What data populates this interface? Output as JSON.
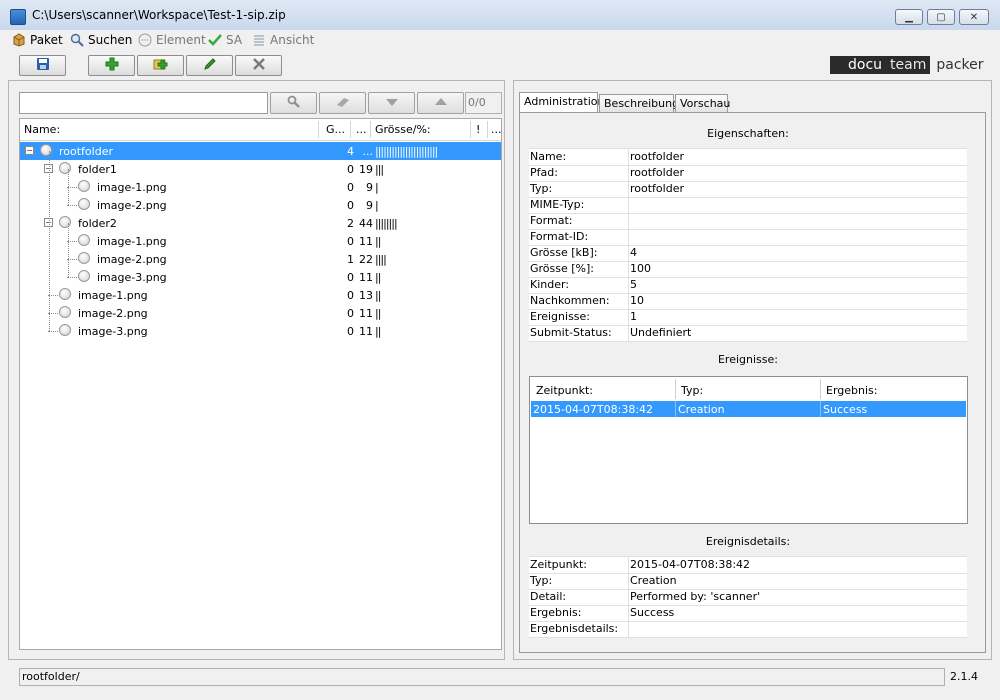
{
  "window": {
    "title": "C:\\Users\\scanner\\Workspace\\Test-1-sip.zip",
    "controls": {
      "minimize": "▁",
      "maximize": "▢",
      "close": "✕"
    }
  },
  "menu": [
    {
      "label": "Paket",
      "icon": "package-icon",
      "enabled": true
    },
    {
      "label": "Suchen",
      "icon": "search-icon",
      "enabled": true
    },
    {
      "label": "Element",
      "icon": "node-icon",
      "enabled": false
    },
    {
      "label": "SA",
      "icon": "check-icon",
      "enabled": false
    },
    {
      "label": "Ansicht",
      "icon": "list-icon",
      "enabled": false
    }
  ],
  "toolbar": {
    "buttons": [
      "save-icon",
      "add-icon",
      "add-folder-icon",
      "edit-icon",
      "delete-icon"
    ],
    "colors": {
      "add": "#2ea52e",
      "edit": "#3c9a2c",
      "delete": "#7a7a7a",
      "save": "#2b5fa8"
    }
  },
  "logo": {
    "part_a": "docu",
    "part_b": "team",
    "part_c": "packer"
  },
  "search": {
    "value": "",
    "counter": "0/0"
  },
  "tree": {
    "columns": [
      "Name:",
      "G...",
      "...",
      "Grösse/%:",
      "!",
      "..."
    ],
    "rows": [
      {
        "name": "rootfolder",
        "g": "4",
        "n": "...",
        "bars": "|||||||||||||||||||||||",
        "depth": 0,
        "folder": true,
        "selected": true
      },
      {
        "name": "folder1",
        "g": "0",
        "n": "19",
        "bars": "|||",
        "depth": 1,
        "folder": true
      },
      {
        "name": "image-1.png",
        "g": "0",
        "n": "9",
        "bars": "|",
        "depth": 2
      },
      {
        "name": "image-2.png",
        "g": "0",
        "n": "9",
        "bars": "|",
        "depth": 2
      },
      {
        "name": "folder2",
        "g": "2",
        "n": "44",
        "bars": "||||||||",
        "depth": 1,
        "folder": true
      },
      {
        "name": "image-1.png",
        "g": "0",
        "n": "11",
        "bars": "||",
        "depth": 2
      },
      {
        "name": "image-2.png",
        "g": "1",
        "n": "22",
        "bars": "||||",
        "depth": 2
      },
      {
        "name": "image-3.png",
        "g": "0",
        "n": "11",
        "bars": "||",
        "depth": 2
      },
      {
        "name": "image-1.png",
        "g": "0",
        "n": "13",
        "bars": "||",
        "depth": 1
      },
      {
        "name": "image-2.png",
        "g": "0",
        "n": "11",
        "bars": "||",
        "depth": 1
      },
      {
        "name": "image-3.png",
        "g": "0",
        "n": "11",
        "bars": "||",
        "depth": 1
      }
    ]
  },
  "tabs": [
    {
      "label": "Administration",
      "active": true
    },
    {
      "label": "Beschreibung",
      "active": false
    },
    {
      "label": "Vorschau",
      "active": false
    }
  ],
  "admin": {
    "properties_title": "Eigenschaften:",
    "properties": [
      {
        "key": "Name:",
        "value": "rootfolder"
      },
      {
        "key": "Pfad:",
        "value": "rootfolder"
      },
      {
        "key": "Typ:",
        "value": "rootfolder"
      },
      {
        "key": "MIME-Typ:",
        "value": ""
      },
      {
        "key": "Format:",
        "value": ""
      },
      {
        "key": "Format-ID:",
        "value": ""
      },
      {
        "key": "Grösse [kB]:",
        "value": "4"
      },
      {
        "key": "Grösse [%]:",
        "value": "100"
      },
      {
        "key": "Kinder:",
        "value": "5"
      },
      {
        "key": "Nachkommen:",
        "value": "10"
      },
      {
        "key": "Ereignisse:",
        "value": "1"
      },
      {
        "key": "Submit-Status:",
        "value": "Undefiniert"
      }
    ],
    "events_title": "Ereignisse:",
    "events_columns": [
      "Zeitpunkt:",
      "Typ:",
      "Ergebnis:"
    ],
    "events": [
      {
        "time": "2015-04-07T08:38:42",
        "type": "Creation",
        "result": "Success"
      }
    ],
    "details_title": "Ereignisdetails:",
    "details": [
      {
        "key": "Zeitpunkt:",
        "value": "2015-04-07T08:38:42"
      },
      {
        "key": "Typ:",
        "value": "Creation"
      },
      {
        "key": "Detail:",
        "value": "Performed by: 'scanner'"
      },
      {
        "key": "Ergebnis:",
        "value": "Success"
      },
      {
        "key": "Ergebnisdetails:",
        "value": ""
      }
    ]
  },
  "status": {
    "path": "rootfolder/",
    "version": "2.1.4"
  }
}
